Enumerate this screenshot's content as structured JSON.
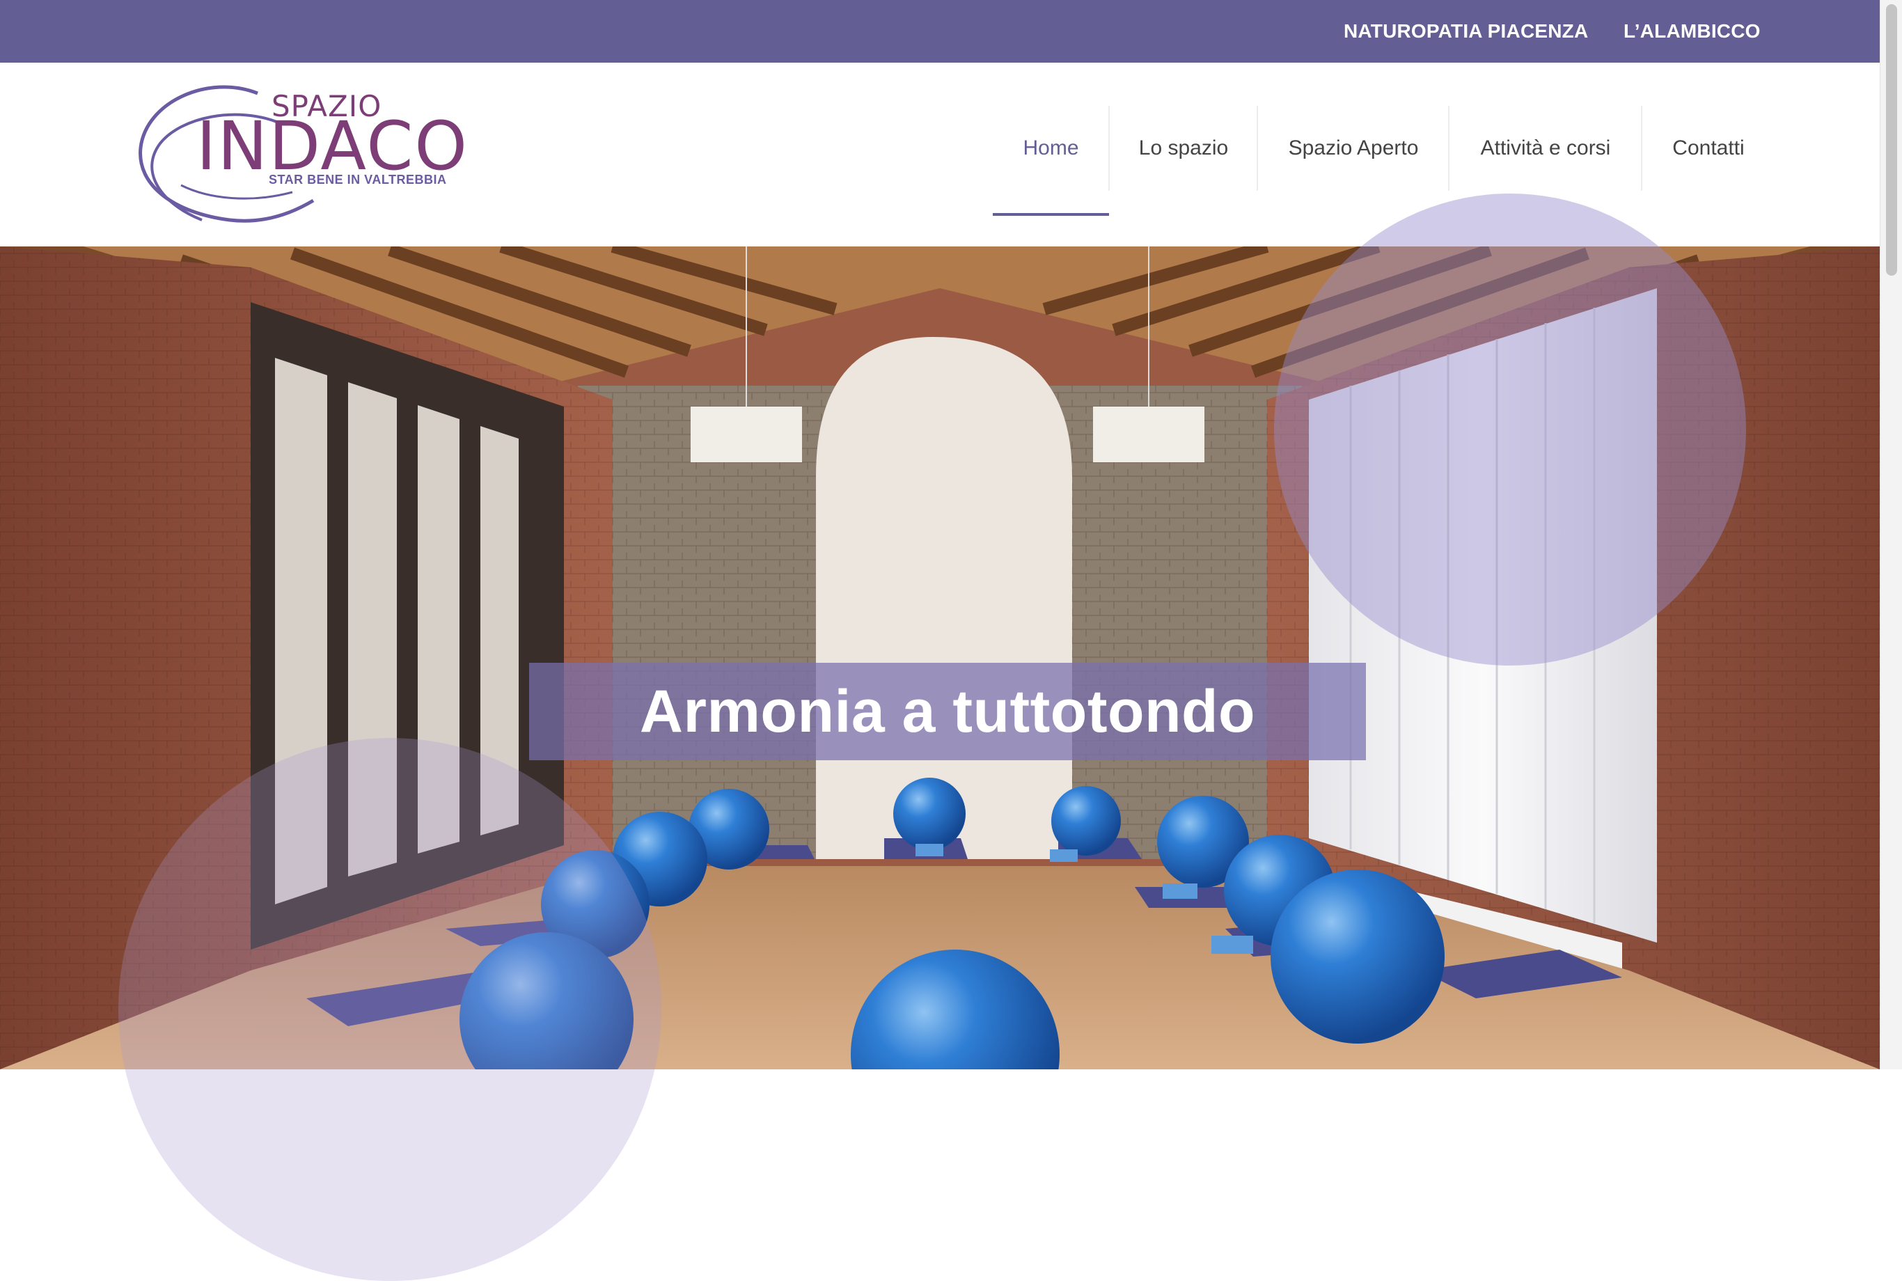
{
  "topbar": {
    "links": [
      {
        "label": "NATUROPATIA PIACENZA"
      },
      {
        "label": "L’ALAMBICCO"
      }
    ]
  },
  "logo": {
    "line1": "SPAZIO",
    "line2": "INDACO",
    "tagline": "STAR BENE IN VALTREBBIA"
  },
  "nav": {
    "items": [
      {
        "label": "Home",
        "active": true
      },
      {
        "label": "Lo spazio"
      },
      {
        "label": "Spazio Aperto"
      },
      {
        "label": "Attività e corsi"
      },
      {
        "label": "Contatti"
      }
    ]
  },
  "hero": {
    "title": "Armonia a tuttotondo"
  },
  "colors": {
    "brand_purple": "#635e93",
    "logo_plum": "#7d3e78",
    "accent_lavender": "#968ccd"
  }
}
